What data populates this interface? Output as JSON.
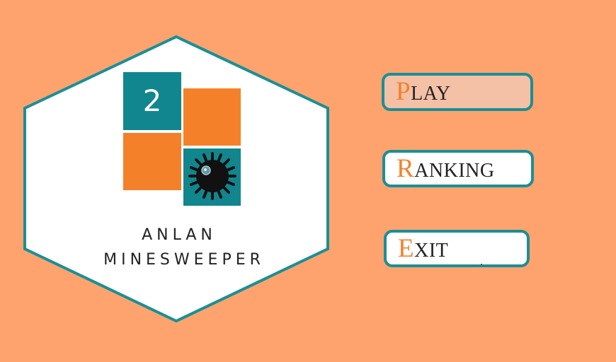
{
  "logo": {
    "number": "2",
    "title_line1": "ANLAN",
    "title_line2": "MINESWEEPER",
    "mine_icon": "mine-icon"
  },
  "menu": {
    "play": {
      "initial": "P",
      "rest": "LAY"
    },
    "ranking": {
      "initial": "R",
      "rest": "ANKING"
    },
    "exit": {
      "initial": "E",
      "rest": "XIT"
    }
  },
  "colors": {
    "background": "#fea36d",
    "teal": "#1a8f96",
    "orange": "#f4812a",
    "play_highlight": "#f4c0a6"
  }
}
